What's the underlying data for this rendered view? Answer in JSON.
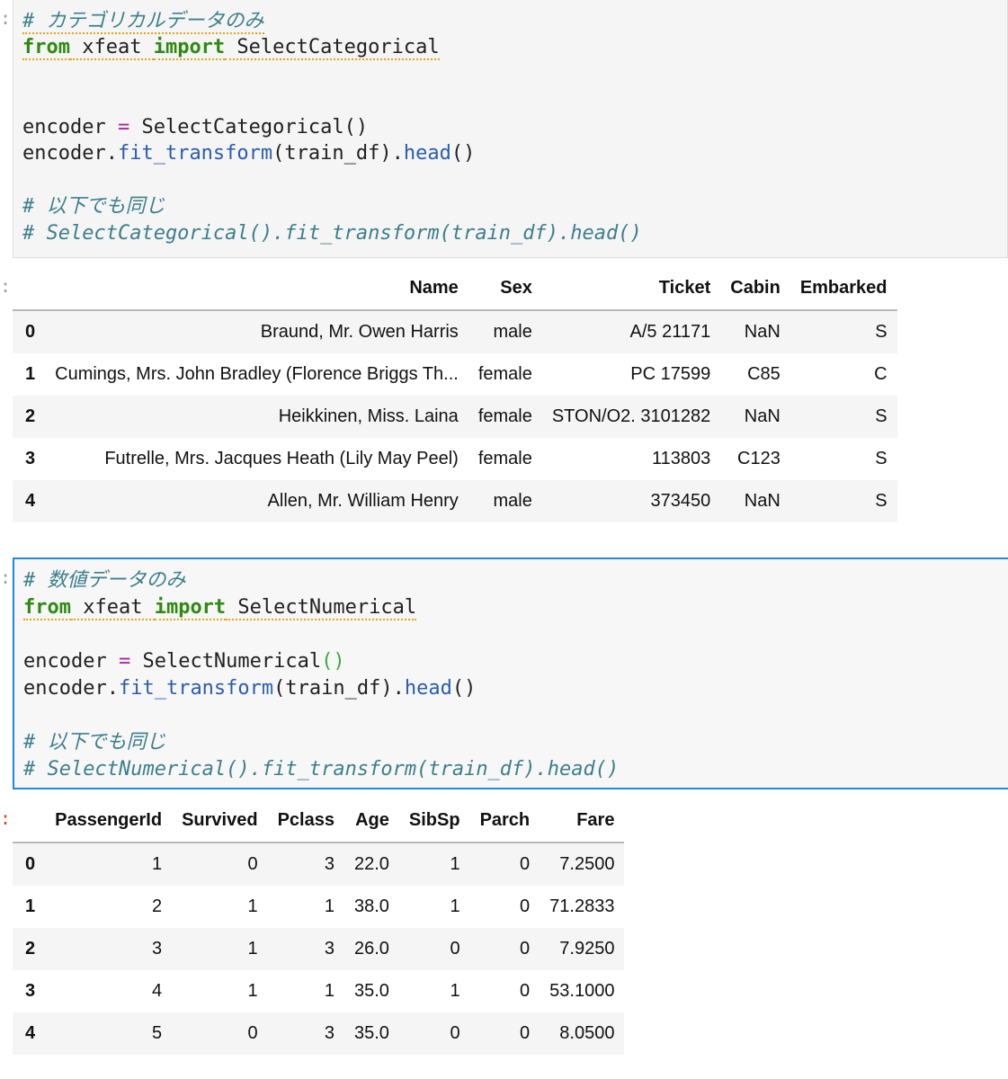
{
  "cells": [
    {
      "lines": [
        {
          "tokens": [
            {
              "t": "# カテゴリカルデータのみ",
              "c": "cm squig"
            }
          ]
        },
        {
          "tokens": [
            {
              "t": "from",
              "c": "kw squig"
            },
            {
              "t": " xfeat ",
              "c": "squig"
            },
            {
              "t": "import",
              "c": "kw squig"
            },
            {
              "t": " SelectCategorical",
              "c": "squig"
            }
          ]
        },
        {
          "tokens": []
        },
        {
          "tokens": []
        },
        {
          "tokens": [
            {
              "t": "encoder ",
              "c": ""
            },
            {
              "t": "=",
              "c": "op"
            },
            {
              "t": " SelectCategorical()",
              "c": ""
            }
          ]
        },
        {
          "tokens": [
            {
              "t": "encoder.",
              "c": ""
            },
            {
              "t": "fit_transform",
              "c": "fn"
            },
            {
              "t": "(train_df).",
              "c": ""
            },
            {
              "t": "head",
              "c": "fn"
            },
            {
              "t": "()",
              "c": ""
            }
          ]
        },
        {
          "tokens": []
        },
        {
          "tokens": [
            {
              "t": "# 以下でも同じ",
              "c": "cm"
            }
          ]
        },
        {
          "tokens": [
            {
              "t": "# SelectCategorical().fit_transform(train_df).head()",
              "c": "cm"
            }
          ]
        }
      ]
    },
    {
      "lines": [
        {
          "tokens": [
            {
              "t": "# 数値データのみ",
              "c": "cm"
            }
          ]
        },
        {
          "tokens": [
            {
              "t": "from",
              "c": "kw squig"
            },
            {
              "t": " xfeat ",
              "c": "squig"
            },
            {
              "t": "import",
              "c": "kw squig"
            },
            {
              "t": " SelectNumerical",
              "c": "squig"
            }
          ]
        },
        {
          "tokens": []
        },
        {
          "tokens": [
            {
              "t": "encoder ",
              "c": ""
            },
            {
              "t": "=",
              "c": "op"
            },
            {
              "t": " SelectNumerical",
              "c": ""
            },
            {
              "t": "()",
              "c": "bgreen"
            }
          ]
        },
        {
          "tokens": [
            {
              "t": "encoder.",
              "c": ""
            },
            {
              "t": "fit_transform",
              "c": "fn"
            },
            {
              "t": "(train_df).",
              "c": ""
            },
            {
              "t": "head",
              "c": "fn"
            },
            {
              "t": "()",
              "c": ""
            }
          ]
        },
        {
          "tokens": []
        },
        {
          "tokens": [
            {
              "t": "# 以下でも同じ",
              "c": "cm"
            }
          ]
        },
        {
          "tokens": [
            {
              "t": "# SelectNumerical().fit_transform(train_df).head()",
              "c": "cm"
            }
          ]
        }
      ]
    }
  ],
  "outputs": [
    {
      "columns": [
        "",
        "Name",
        "Sex",
        "Ticket",
        "Cabin",
        "Embarked"
      ],
      "rows": [
        [
          "0",
          "Braund, Mr. Owen Harris",
          "male",
          "A/5 21171",
          "NaN",
          "S"
        ],
        [
          "1",
          "Cumings, Mrs. John Bradley (Florence Briggs Th...",
          "female",
          "PC 17599",
          "C85",
          "C"
        ],
        [
          "2",
          "Heikkinen, Miss. Laina",
          "female",
          "STON/O2. 3101282",
          "NaN",
          "S"
        ],
        [
          "3",
          "Futrelle, Mrs. Jacques Heath (Lily May Peel)",
          "female",
          "113803",
          "C123",
          "S"
        ],
        [
          "4",
          "Allen, Mr. William Henry",
          "male",
          "373450",
          "NaN",
          "S"
        ]
      ]
    },
    {
      "columns": [
        "",
        "PassengerId",
        "Survived",
        "Pclass",
        "Age",
        "SibSp",
        "Parch",
        "Fare"
      ],
      "rows": [
        [
          "0",
          "1",
          "0",
          "3",
          "22.0",
          "1",
          "0",
          "7.2500"
        ],
        [
          "1",
          "2",
          "1",
          "1",
          "38.0",
          "1",
          "0",
          "71.2833"
        ],
        [
          "2",
          "3",
          "1",
          "3",
          "26.0",
          "0",
          "0",
          "7.9250"
        ],
        [
          "3",
          "4",
          "1",
          "1",
          "35.0",
          "1",
          "0",
          "53.1000"
        ],
        [
          "4",
          "5",
          "0",
          "3",
          "35.0",
          "0",
          "0",
          "8.0500"
        ]
      ]
    }
  ],
  "prompt_marks": [
    ":",
    ":",
    ":",
    ":"
  ],
  "colors": {
    "active_border": "#1e88e5",
    "comment": "#3d7f8c",
    "keyword": "#2f8a12",
    "function": "#2a5db0",
    "operator": "#a626a4",
    "out_prompt": "#d84315"
  }
}
